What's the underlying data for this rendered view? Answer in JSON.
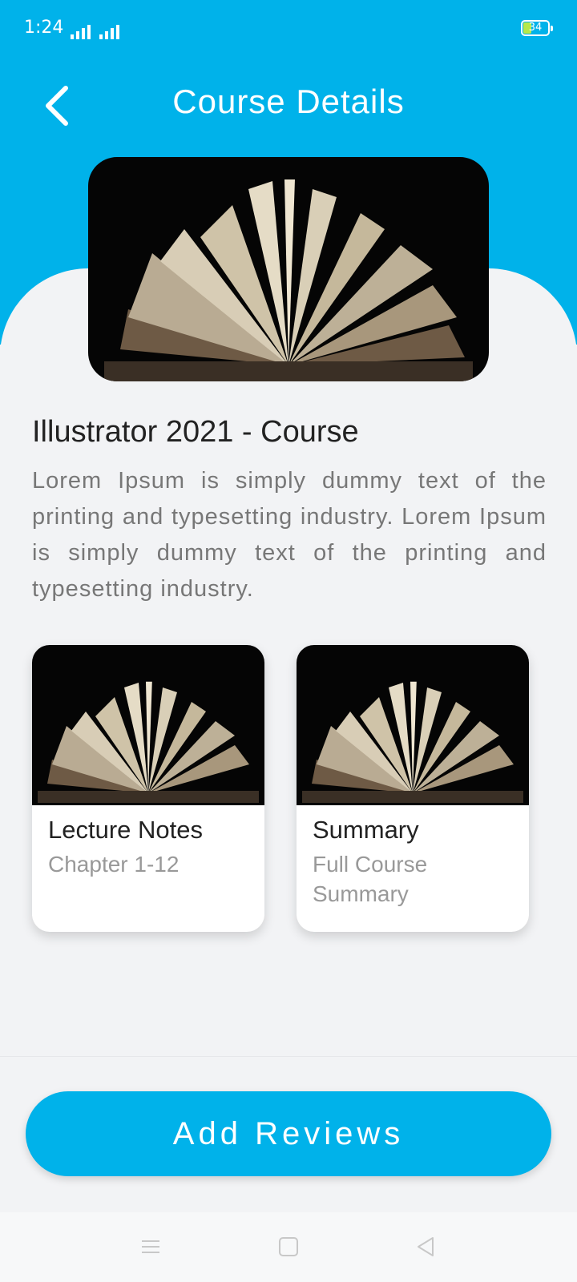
{
  "status_bar": {
    "time": "1:24",
    "battery": "34"
  },
  "header": {
    "title": "Course Details",
    "back_icon": "chevron-left-icon"
  },
  "course": {
    "title": "Illustrator 2021 - Course",
    "description": "Lorem Ipsum is simply dummy text of the printing and typesetting industry. Lorem Ipsum is simply dummy text of the printing and typesetting industry."
  },
  "cards": [
    {
      "title": "Lecture Notes",
      "subtitle": "Chapter 1-12"
    },
    {
      "title": "Summary",
      "subtitle": "Full Course Summary"
    }
  ],
  "actions": {
    "add_reviews": "Add Reviews"
  },
  "colors": {
    "accent": "#00b2ea",
    "background": "#f2f3f5"
  }
}
